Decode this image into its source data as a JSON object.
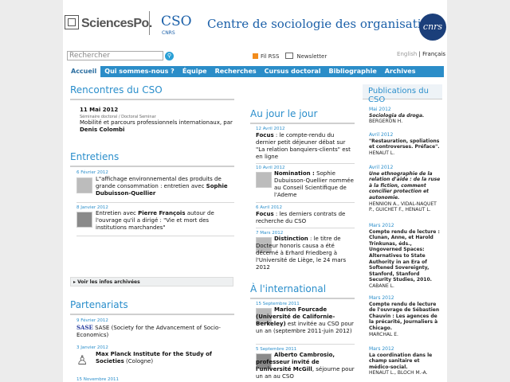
{
  "header": {
    "logo_sciencespo": "SciencesPo.",
    "cso": "CSO",
    "cnrs_sub": "CNRS",
    "centre_title": "Centre de sociologie des organisations",
    "cnrs_logo": "cnrs"
  },
  "toolbar": {
    "search_placeholder": "Rechercher",
    "rss": "Fil RSS",
    "newsletter": "Newsletter",
    "lang_en": "English",
    "lang_sep": "|",
    "lang_fr": "Français"
  },
  "nav": [
    "Accueil",
    "Qui sommes-nous ?",
    "Équipe",
    "Recherches",
    "Cursus doctoral",
    "Bibliographie",
    "Archives"
  ],
  "rencontres": {
    "title": "Rencontres du CSO",
    "date": "11 Mai 2012",
    "subtitle": "Séminaire doctoral / Doctoral Seminar",
    "text": "Mobilité et parcours professionnels internationaux, par",
    "author": "Denis Colombi"
  },
  "entretiens": {
    "title": "Entretiens",
    "items": [
      {
        "date": "6 Février 2012",
        "text": "L\"affichage environnemental des produits de grande consommation : entretien avec",
        "bold": "Sophie Dubuisson-Quellier"
      },
      {
        "date": "8 Janvier 2012",
        "pre": "Entretien avec ",
        "bold": "Pierre François",
        "text": " autour de l'ouvrage qu'il a dirigé : \"Vie et mort des institutions marchandes\""
      }
    ],
    "archives": "Voir les infos archivées"
  },
  "partenariats": {
    "title": "Partenariats",
    "items": [
      {
        "date": "9 Février 2012",
        "logo": "SASE",
        "text": " (Society for the Advancement of Socio-Economics)"
      },
      {
        "date": "3 Janvier 2012",
        "bold": "Max Planck Institute for the Study of Societies",
        "text": " (Cologne)"
      },
      {
        "date": "15 Novembre 2011"
      }
    ]
  },
  "jour": {
    "title": "Au jour le jour",
    "items": [
      {
        "date": "12 Avril 2012",
        "bold": "Focus",
        "text": " : le compte-rendu du dernier petit déjeuner débat sur \"La relation banquiers-clients\" est en ligne"
      },
      {
        "date": "10 Avril 2012",
        "bold": "Nomination :",
        "text": " Sophie Dubuisson-Quellier nommée au Conseil Scientifique de l'Ademe"
      },
      {
        "date": "6 Avril 2012",
        "bold": "Focus",
        "text": " : les derniers contrats de recherche du CSO"
      },
      {
        "date": "7 Mars 2012",
        "bold": "Distinction",
        "text": " : le titre de Docteur honoris causa a été décerné à Erhard Friedberg à l'Université de Liège, le 24 mars 2012"
      }
    ]
  },
  "international": {
    "title": "À l'international",
    "items": [
      {
        "date": "15 Septembre 2011",
        "bold": "Marion Fourcade (Université de Californie-Berkeley)",
        "text": " est invitée au CSO pour un an (septembre 2011-juin 2012)"
      },
      {
        "date": "5 Septembre 2011",
        "bold": "Alberto Cambrosio, professeur invité de l'université McGill",
        "text": ", séjourne pour un an au CSO"
      }
    ]
  },
  "publications": {
    "title": "Publications du CSO",
    "items": [
      {
        "date": "Mai 2012",
        "title": "Sociologia da droga.",
        "authors": "BERGERON H."
      },
      {
        "date": "Avril 2012",
        "title": "\"Restauration, spoliations et controverses. Préface\".",
        "authors": "HENAUT L."
      },
      {
        "date": "Avril 2012",
        "title": "Une ethnographie de la relation d'aide : de la ruse à la fiction, comment concilier protection et autonomie.",
        "authors": "HENNION A., VIDAL-NAQUET P., GUICHET F., HENAUT L."
      },
      {
        "date": "Mars 2012",
        "title": "Compte rendu de lecture : Clunan, Anne, et Harold Trinkunas, éds., Ungoverned Spaces: Alternatives to State Authority in an Era of Softened Sovereignty, Stanford, Stanford Security Studies, 2010.",
        "authors": "CABANE L."
      },
      {
        "date": "Mars 2012",
        "title": "Compte rendu de lecture de l'ouvrage de Sébastien Chauvin : Les agences de la précarité, Journaliers à Chicago.",
        "authors": "MARCHAL E."
      },
      {
        "date": "Mars 2012",
        "title": "La coordination dans le champ sanitaire et médico-social.",
        "authors": "HENAUT L., BLOCH M.-A."
      }
    ]
  }
}
